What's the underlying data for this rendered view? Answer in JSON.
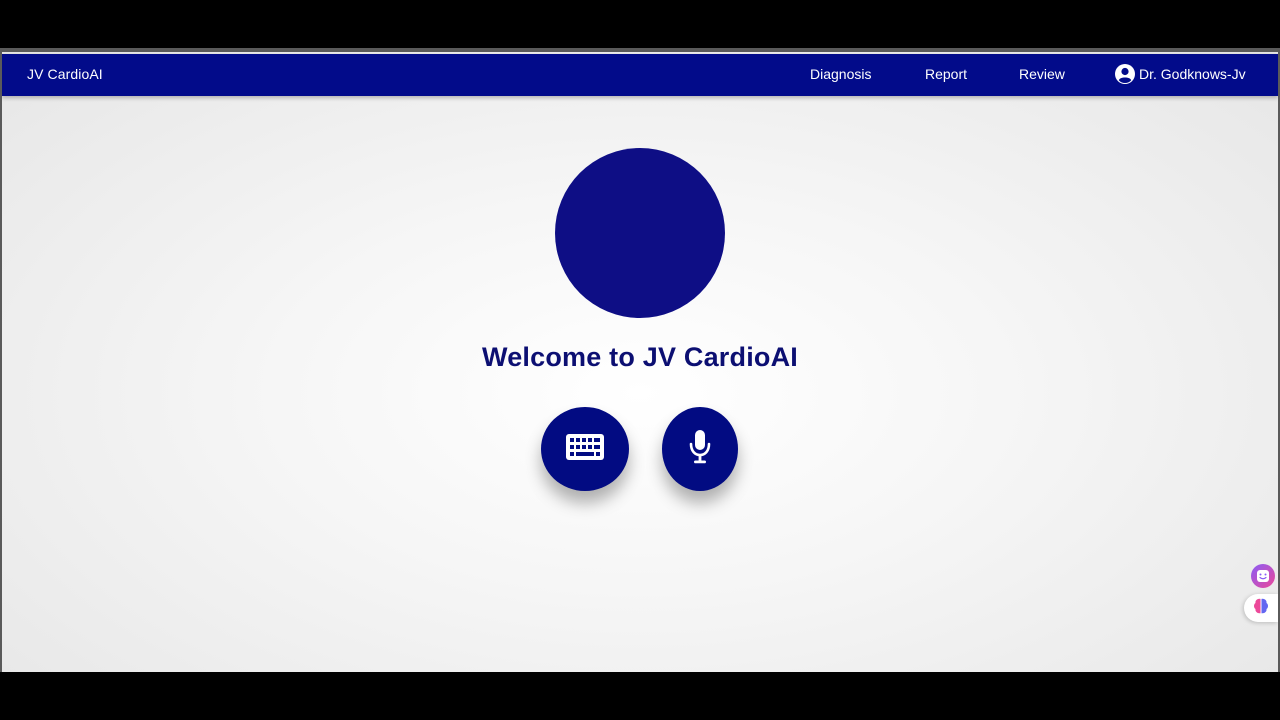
{
  "navbar": {
    "brand": "JV CardioAI",
    "links": [
      {
        "label": "Diagnosis"
      },
      {
        "label": "Report"
      },
      {
        "label": "Review"
      }
    ],
    "user": {
      "name": "Dr. Godknows-Jv",
      "icon": "user-circle-icon"
    }
  },
  "main": {
    "welcome_text": "Welcome to JV CardioAI",
    "buttons": [
      {
        "icon": "keyboard-icon"
      },
      {
        "icon": "microphone-icon"
      }
    ]
  },
  "side_widgets": [
    {
      "icon": "smiley-face-icon"
    },
    {
      "icon": "brain-icon"
    }
  ],
  "colors": {
    "navbar": "#020b8a",
    "accent": "#0e0e85",
    "title": "#0c0f72"
  }
}
